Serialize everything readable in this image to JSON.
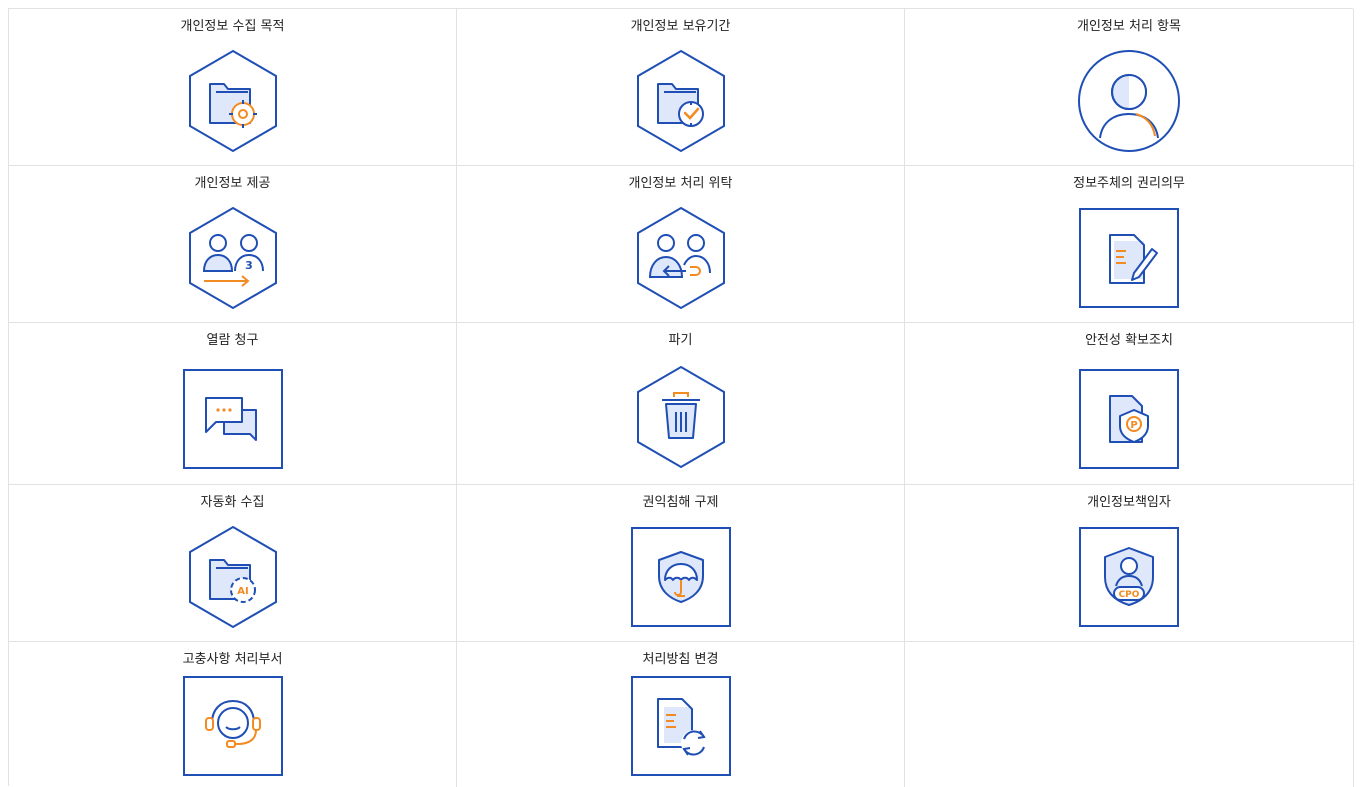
{
  "colors": {
    "outline": "#1f4fb5",
    "accent": "#f28b22",
    "fill": "#dfe7fb",
    "border": "#e2e2e2",
    "text": "#222222"
  },
  "items": [
    {
      "label": "개인정보 수집 목적",
      "icon": "folder-gear-icon",
      "frame": "hexagon"
    },
    {
      "label": "개인정보 보유기간",
      "icon": "folder-clock-icon",
      "frame": "hexagon"
    },
    {
      "label": "개인정보 처리 항목",
      "icon": "person-icon",
      "frame": "circle"
    },
    {
      "label": "개인정보 제공",
      "icon": "third-party-provision-icon",
      "frame": "hexagon"
    },
    {
      "label": "개인정보 처리 위탁",
      "icon": "outsourcing-icon",
      "frame": "hexagon"
    },
    {
      "label": "정보주체의 권리의무",
      "icon": "document-pen-icon",
      "frame": "square"
    },
    {
      "label": "열람 청구",
      "icon": "chat-bubbles-icon",
      "frame": "square"
    },
    {
      "label": "파기",
      "icon": "trash-bin-icon",
      "frame": "hexagon"
    },
    {
      "label": "안전성 확보조치",
      "icon": "document-shield-icon",
      "frame": "square"
    },
    {
      "label": "자동화 수집",
      "icon": "folder-ai-icon",
      "frame": "hexagon"
    },
    {
      "label": "권익침해 구제",
      "icon": "umbrella-shield-icon",
      "frame": "square"
    },
    {
      "label": "개인정보책임자",
      "icon": "cpo-shield-icon",
      "frame": "square"
    },
    {
      "label": "고충사항 처리부서",
      "icon": "headset-icon",
      "frame": "square"
    },
    {
      "label": "처리방침 변경",
      "icon": "document-refresh-icon",
      "frame": "square"
    }
  ],
  "badges": {
    "provision_number": "3",
    "ai_text": "AI",
    "security_letter": "P",
    "cpo_text": "CPO"
  }
}
